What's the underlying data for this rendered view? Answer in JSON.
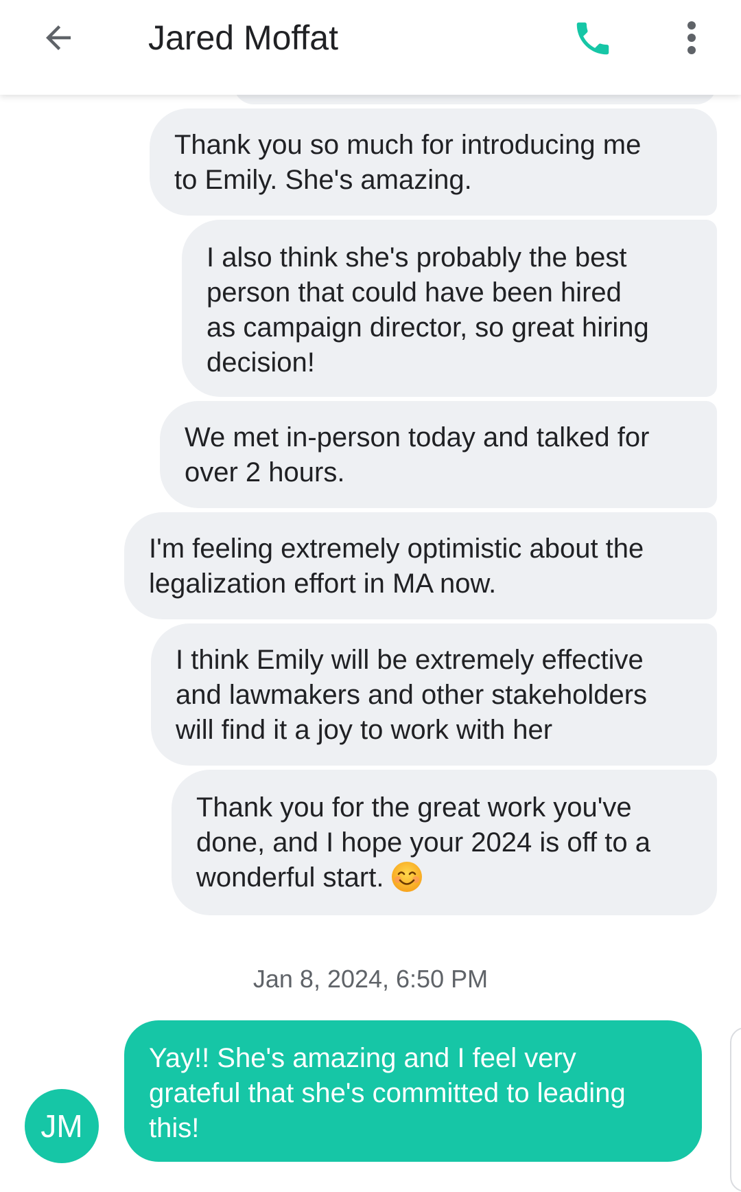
{
  "header": {
    "title": "Jared Moffat",
    "back_icon": "arrow-left-icon",
    "call_icon": "phone-icon",
    "more_icon": "more-vert-icon"
  },
  "colors": {
    "accent": "#16c6a6",
    "incoming_bubble": "#eef0f3",
    "text": "#202124",
    "timestamp": "#5f6368"
  },
  "messages": {
    "incoming": [
      {
        "lines": [
          "Thank you so much for introducing me",
          "to Emily. She's amazing."
        ]
      },
      {
        "lines": [
          "I also think she's probably the best",
          "person that could have been hired",
          "as campaign director, so great hiring",
          "decision!"
        ]
      },
      {
        "lines": [
          "We met in-person today and talked for",
          "over 2 hours."
        ]
      },
      {
        "lines": [
          "I'm feeling extremely optimistic about the",
          "legalization effort in MA now."
        ]
      },
      {
        "lines": [
          "I think Emily will be extremely effective",
          "and lawmakers and other stakeholders",
          "will find it a joy to work with her"
        ]
      },
      {
        "lines": [
          "Thank you for the great work you've",
          "done, and I hope your 2024 is off to a",
          "wonderful start."
        ],
        "emoji": "smiling-face-emoji"
      }
    ],
    "timestamp": "Jan 8, 2024, 6:50 PM",
    "outgoing": {
      "avatar_initials": "JM",
      "lines": [
        "Yay!! She's amazing and I feel very",
        "grateful that she's committed to leading",
        "this!"
      ]
    }
  }
}
